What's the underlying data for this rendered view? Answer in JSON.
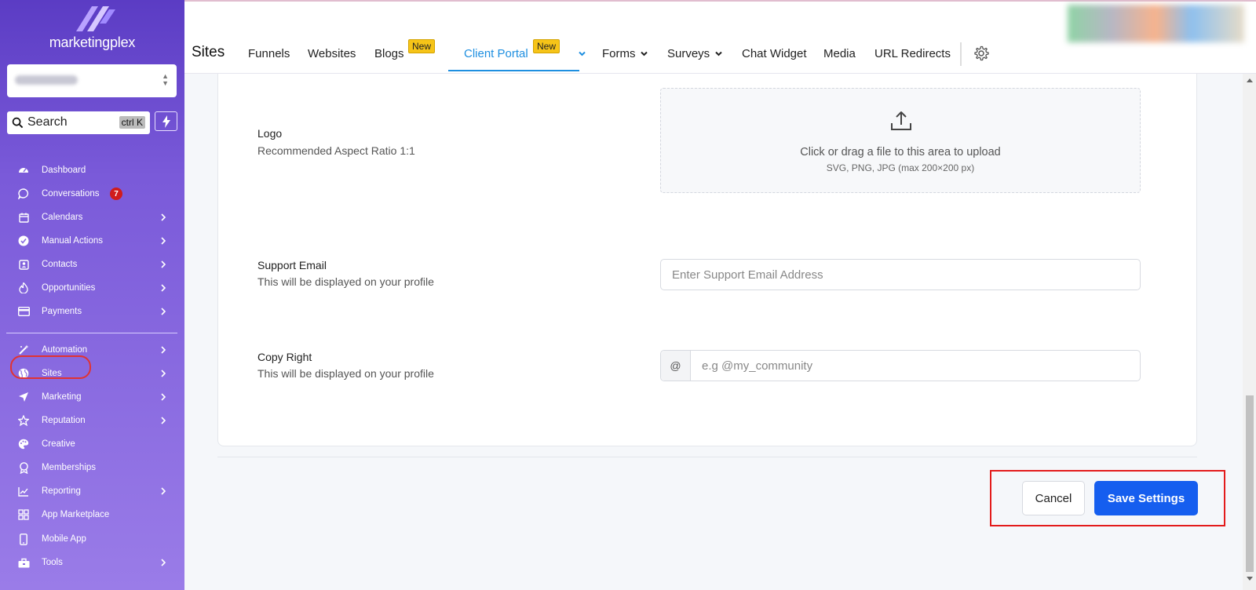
{
  "brand": {
    "name": "marketingplex"
  },
  "search": {
    "label": "Search",
    "shortcut": "ctrl K"
  },
  "sidebar": {
    "items": [
      {
        "label": "Dashboard",
        "icon": "dashboard-icon"
      },
      {
        "label": "Conversations",
        "icon": "chat-icon",
        "badge": "7"
      },
      {
        "label": "Calendars",
        "icon": "calendar-icon"
      },
      {
        "label": "Manual Actions",
        "icon": "check-circle-icon"
      },
      {
        "label": "Contacts",
        "icon": "contacts-icon"
      },
      {
        "label": "Opportunities",
        "icon": "flame-icon"
      },
      {
        "label": "Payments",
        "icon": "card-icon"
      },
      {
        "label": "Automation",
        "icon": "wand-icon"
      },
      {
        "label": "Sites",
        "icon": "globe-icon"
      },
      {
        "label": "Marketing",
        "icon": "send-icon"
      },
      {
        "label": "Reputation",
        "icon": "star-icon"
      },
      {
        "label": "Creative",
        "icon": "palette-icon"
      },
      {
        "label": "Memberships",
        "icon": "award-icon"
      },
      {
        "label": "Reporting",
        "icon": "chart-icon"
      },
      {
        "label": "App Marketplace",
        "icon": "grid-icon"
      },
      {
        "label": "Mobile App",
        "icon": "phone-icon"
      },
      {
        "label": "Tools",
        "icon": "toolbox-icon"
      }
    ]
  },
  "header": {
    "title": "Sites",
    "tabs": [
      {
        "label": "Funnels"
      },
      {
        "label": "Websites"
      },
      {
        "label": "Blogs",
        "badge": "New"
      },
      {
        "label": "Client Portal",
        "badge": "New"
      },
      {
        "label": "Forms"
      },
      {
        "label": "Surveys"
      },
      {
        "label": "Chat Widget"
      },
      {
        "label": "Media"
      },
      {
        "label": "URL Redirects"
      }
    ]
  },
  "form": {
    "logo": {
      "title": "Logo",
      "subtitle": "Recommended Aspect Ratio 1:1",
      "upload_text": "Click or drag a file to this area to upload",
      "upload_hint": "SVG, PNG, JPG (max 200×200 px)"
    },
    "support_email": {
      "title": "Support Email",
      "subtitle": "This will be displayed on your profile",
      "placeholder": "Enter Support Email Address"
    },
    "copyright": {
      "title": "Copy Right",
      "subtitle": "This will be displayed on your profile",
      "prefix": "@",
      "placeholder": "e.g @my_community"
    }
  },
  "actions": {
    "cancel": "Cancel",
    "save": "Save Settings"
  },
  "colors": {
    "accent": "#1e8fe0",
    "primary_button": "#155eef",
    "badge": "#f6c418",
    "highlight": "#e31b1b"
  }
}
